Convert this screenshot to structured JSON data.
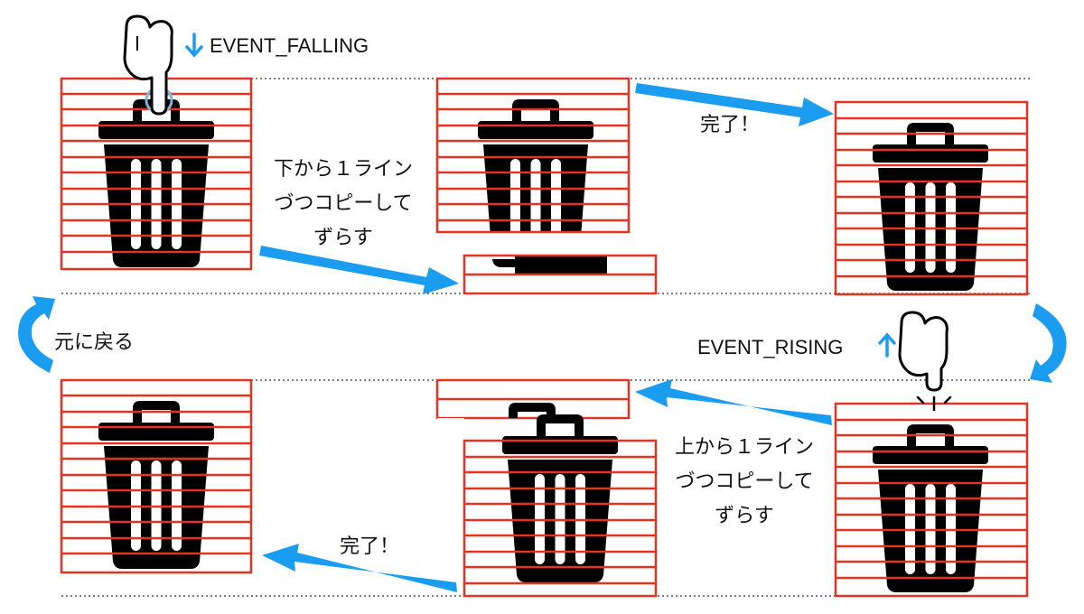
{
  "labels": {
    "event_falling": "EVENT_FALLING",
    "event_rising": "EVENT_RISING",
    "down_line1": "下から１ライン",
    "down_line2": "づつコピーして",
    "down_line3": "ずらす",
    "up_line1": "上から１ライン",
    "up_line2": "づつコピーして",
    "up_line3": "ずらす",
    "done_top": "完了！",
    "done_bottom": "完了！",
    "reset": "元に戻る"
  },
  "colors": {
    "grid": "#e53322",
    "arrow": "#1a9cf0",
    "can": "#000000",
    "touch_ring": "#7bb8d8"
  },
  "icons": {
    "trash": "trash-can-icon",
    "hand": "pointing-hand-icon",
    "arrow": "flow-arrow"
  }
}
